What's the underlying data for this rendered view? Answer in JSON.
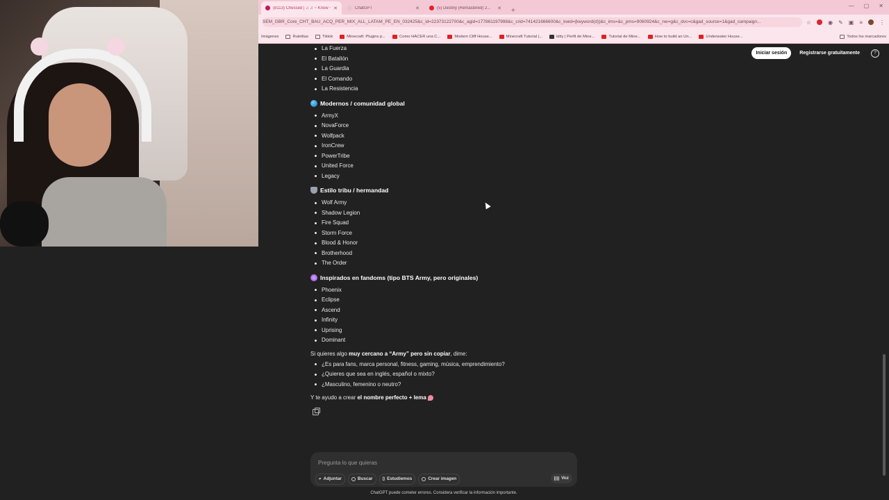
{
  "browser": {
    "tabs": [
      {
        "title": "(8113) Chessed | ♫ ♫ ~ Know ~",
        "active": true
      },
      {
        "title": "ChatGPT",
        "active": false
      },
      {
        "title": "(5) Destiny (Remastered) 2...",
        "active": false
      }
    ],
    "url": "SEM_GBR_Core_CHT_BAU_ACQ_PER_MIX_ALL_LATAM_PE_EN_032425&c_id=22373122700&c_agid=177861197998&c_crid=741421666600&c_kwid={keyword(d)}&c_ims=&c_pms=9060924&c_nw=g&c_dvc=c&gad_source=1&gad_campaign...",
    "bookmarks": [
      {
        "label": "Imágenes",
        "icon": "none"
      },
      {
        "label": "Ruletitas",
        "icon": "folder"
      },
      {
        "label": "Tiktok",
        "icon": "folder"
      },
      {
        "label": "Minecraft: Plugins p...",
        "icon": "youtube"
      },
      {
        "label": "Como HACER una C...",
        "icon": "youtube"
      },
      {
        "label": "Modern Cliff House...",
        "icon": "youtube"
      },
      {
        "label": "Minecraft Tutorial |...",
        "icon": "youtube"
      },
      {
        "label": "kitty | Perfil de Mine...",
        "icon": "dark"
      },
      {
        "label": "Tutorial de Mine...",
        "icon": "youtube"
      },
      {
        "label": "How to build an Un...",
        "icon": "youtube"
      },
      {
        "label": "Underwater House...",
        "icon": "youtube"
      }
    ],
    "all_bookmarks": "Todos los marcadores"
  },
  "header": {
    "login": "Iniciar sesión",
    "register": "Registrarse gratuitamente"
  },
  "response": {
    "first_list": [
      "La Fuerza",
      "El Batallón",
      "La Guardia",
      "El Comando",
      "La Resistencia"
    ],
    "sections": [
      {
        "heading": "Modernos / comunidad global",
        "emoji": "globe",
        "items": [
          "ArmyX",
          "NovaForce",
          "Wolfpack",
          "IronCrew",
          "PowerTribe",
          "United Force",
          "Legacy"
        ]
      },
      {
        "heading": "Estilo tribu / hermandad",
        "emoji": "wolf",
        "items": [
          "Wolf Army",
          "Shadow Legion",
          "Fire Squad",
          "Storm Force",
          "Blood & Honor",
          "Brotherhood",
          "The Order"
        ]
      },
      {
        "heading": "Inspirados en fandoms (tipo BTS Army, pero originales)",
        "emoji": "spark",
        "items": [
          "Phoenix",
          "Eclipse",
          "Ascend",
          "Infinity",
          "Uprising",
          "Dominant"
        ]
      }
    ],
    "para1_pre": "Si quieres algo ",
    "para1_bold": "muy cercano a “Army” pero sin copiar",
    "para1_post": ", dime:",
    "questions": [
      "¿Es para fans, marca personal, fitness, gaming, música, emprendimiento?",
      "¿Quieres que sea en inglés, español o mixto?",
      "¿Masculino, femenino o neutro?"
    ],
    "para2_pre": "Y te ayudo a crear ",
    "para2_bold": "el nombre perfecto + lema"
  },
  "composer": {
    "placeholder": "Pregunta lo que quieras",
    "tools": [
      "Adjuntar",
      "Buscar",
      "Estudiemos",
      "Crear imagen"
    ],
    "voice": "Voz"
  },
  "disclaimer": "ChatGPT puede cometer errores. Considera verificar la información importante."
}
